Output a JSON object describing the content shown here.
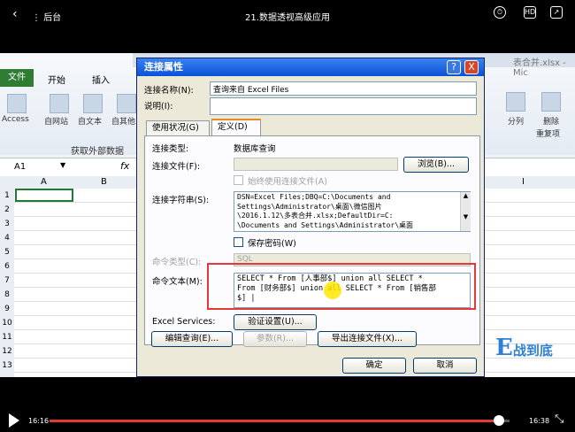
{
  "player": {
    "back_label": "后台",
    "title": "21.数据透视高级应用",
    "time_current": "16:16",
    "time_total": "16:38",
    "progress_fraction": 0.976
  },
  "excel": {
    "tab_file": "文件",
    "tab_start": "开始",
    "tab_insert": "插入",
    "ribbon_left_items": [
      "Access",
      "自网站",
      "自文本",
      "自其他"
    ],
    "group_label": "获取外部数据",
    "ribbon_right_items": [
      "分列",
      "删除",
      "重复项"
    ],
    "window_title_tail": "表合并.xlsx - Mic",
    "name_box": "A1",
    "fx": "fx",
    "col_a": "A",
    "col_b": "B",
    "col_i": "I",
    "row_numbers": [
      "1",
      "2",
      "3",
      "4",
      "5",
      "6",
      "7",
      "8",
      "9",
      "10",
      "11",
      "12",
      "13"
    ]
  },
  "dialog": {
    "title": "连接属性",
    "help_btn": "?",
    "close_btn": "X",
    "conn_name_label": "连接名称(N):",
    "conn_name_value": "查询来自 Excel Files",
    "desc_label": "说明(I):",
    "tab_usage": "使用状况(G)",
    "tab_definition": "定义(D)",
    "conn_type_label": "连接类型:",
    "conn_type_value": "数据库查询",
    "conn_file_label": "连接文件(F):",
    "browse_btn": "浏览(B)...",
    "always_use_file": "始终使用连接文件(A)",
    "conn_string_label": "连接字符串(S):",
    "conn_string_lines": [
      "DSN=Excel Files;DBQ=C:\\Documents and",
      "Settings\\Administrator\\桌面\\微信图片",
      "\\2016.1.12\\多表合并.xlsx;DefaultDir=C:",
      "\\Documents and Settings\\Administrator\\桌面"
    ],
    "save_password": "保存密码(W)",
    "cmd_type_label": "命令类型(C):",
    "cmd_type_value": "SQL",
    "cmd_text_label": "命令文本(M):",
    "cmd_text_lines": [
      "SELECT * From [人事部$] union all SELECT *",
      "From [财务部$] union all SELECT * From [销售部",
      "$] |"
    ],
    "excel_services_label": "Excel Services:",
    "auth_btn": "验证设置(U)...",
    "edit_query_btn": "编辑查询(E)...",
    "params_btn": "参数(R)...",
    "export_btn": "导出连接文件(X)...",
    "ok_btn": "确定",
    "cancel_btn": "取消"
  },
  "watermark": {
    "e": "E",
    "text": "战到底"
  },
  "colors": {
    "highlight_box": "#e53935",
    "progress": "#e53935",
    "file_tab": "#2e7d32",
    "dialog_title": "#0a52d6"
  }
}
